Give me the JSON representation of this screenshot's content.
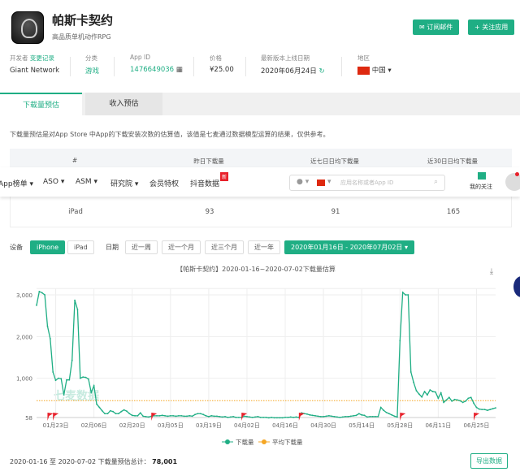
{
  "app": {
    "name": "帕斯卡契约",
    "subtitle": "高品质单机动作RPG"
  },
  "actions": {
    "subscribe": "订阅邮件",
    "follow": "关注应用"
  },
  "meta": {
    "developer_label": "开发者",
    "changelog_link": "变更记录",
    "developer": "Giant Network",
    "category_label": "分类",
    "category": "游戏",
    "appid_label": "App ID",
    "appid": "1476649036",
    "price_label": "价格",
    "price": "¥25.00",
    "release_label": "最新版本上线日期",
    "release": "2020年06月24日",
    "region_label": "地区",
    "region": "中国"
  },
  "tabs": [
    {
      "label": "下载量预估",
      "active": true
    },
    {
      "label": "收入预估",
      "active": false
    }
  ],
  "description": "下载量预估是对App Store 中App的下载安装次数的估算值，该值是七麦通过数据模型运算的结果，仅供参考。",
  "table": {
    "headers": [
      "#",
      "昨日下载量",
      "近七日日均下载量",
      "近30日日均下载量"
    ],
    "rows": [
      {
        "device": "iPad",
        "yesterday": "93",
        "avg7": "91",
        "avg30": "165"
      }
    ]
  },
  "navbar": {
    "items": [
      "App榜单 ▾",
      "ASO ▾",
      "ASM ▾",
      "研究院 ▾",
      "会员特权",
      "抖音数据"
    ],
    "new_badge": "新",
    "search_placeholder": "应用名称或者App ID",
    "my_follow": "我的关注"
  },
  "filters": {
    "device_label": "设备",
    "devices": [
      "iPhone",
      "iPad"
    ],
    "active_device": "iPhone",
    "date_label": "日期",
    "ranges": [
      "近一周",
      "近一个月",
      "近三个月",
      "近一年"
    ],
    "date_range": "2020年01月16日 - 2020年07月02日 ▾"
  },
  "colors": {
    "accent": "#1fae84",
    "average": "#f5a623",
    "event_flag": "#e8202a"
  },
  "chart_data": {
    "type": "line",
    "title": "【帕斯卡契约】2020-01-16~2020-07-02下载量估算",
    "watermark": "七麦数据",
    "start_date": "2020-01-16",
    "end_date": "2020-07-02",
    "x_ticks": [
      "01月23日",
      "02月06日",
      "02月20日",
      "03月05日",
      "03月19日",
      "04月02日",
      "04月16日",
      "04月30日",
      "05月14日",
      "05月28日",
      "06月11日",
      "06月25日"
    ],
    "y_ticks": [
      "58",
      "1,000",
      "2,000",
      "3,000"
    ],
    "ylim": [
      58,
      3150
    ],
    "grid": true,
    "legend_position": "bottom",
    "series": [
      {
        "name": "下载量",
        "values": [
          2750,
          3080,
          3050,
          3000,
          2250,
          1950,
          1150,
          950,
          1000,
          990,
          600,
          960,
          960,
          1430,
          2870,
          2650,
          1000,
          1030,
          1020,
          980,
          660,
          820,
          380,
          300,
          220,
          150,
          150,
          220,
          200,
          150,
          150,
          200,
          240,
          210,
          150,
          110,
          100,
          100,
          170,
          90,
          80,
          70,
          90,
          100,
          100,
          100,
          110,
          100,
          90,
          100,
          100,
          90,
          100,
          100,
          90,
          90,
          100,
          90,
          130,
          150,
          150,
          130,
          100,
          80,
          100,
          90,
          90,
          80,
          70,
          80,
          60,
          70,
          80,
          60,
          60,
          60,
          90,
          80,
          70,
          60,
          70,
          80,
          60,
          60,
          60,
          50,
          60,
          50,
          50,
          50,
          50,
          60,
          60,
          70,
          60,
          70,
          60,
          170,
          150,
          140,
          120,
          110,
          100,
          90,
          80,
          80,
          90,
          100,
          90,
          80,
          70,
          60,
          70,
          80,
          80,
          90,
          100,
          110,
          150,
          120,
          110,
          70,
          80,
          80,
          80,
          80,
          300,
          230,
          180,
          150,
          120,
          90,
          70,
          1900,
          3060,
          3000,
          3000,
          1150,
          900,
          700,
          620,
          550,
          680,
          600,
          720,
          680,
          670,
          520,
          650,
          420,
          480,
          540,
          450,
          490,
          480,
          460,
          420,
          450,
          520,
          540,
          400,
          300,
          260,
          250,
          250,
          230,
          250,
          270,
          290
        ]
      },
      {
        "name": "平均下载量",
        "value": 462
      }
    ],
    "event_dates": [
      "2020-01-20",
      "2020-01-22",
      "2020-02-27",
      "2020-03-31",
      "2020-04-21",
      "2020-05-28",
      "2020-06-24"
    ]
  },
  "footer": {
    "summary": "2020-01-16 至 2020-07-02 下载量预估总计：",
    "total": "78,001",
    "export": "导出数据"
  }
}
